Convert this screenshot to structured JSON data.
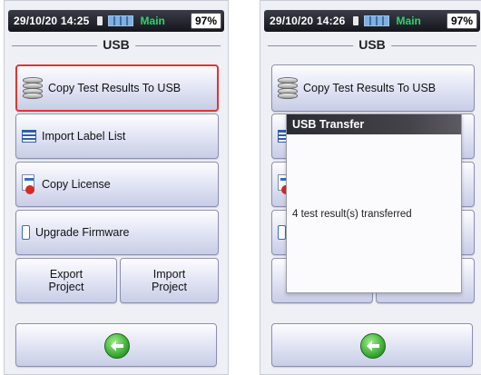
{
  "left": {
    "statusbar": {
      "time": "29/10/20 14:25",
      "mode": "Main",
      "battery": "97%"
    },
    "title": "USB",
    "buttons": {
      "copy_results": "Copy Test Results To USB",
      "import_label": "Import Label List",
      "copy_license": "Copy License",
      "upgrade_firmware": "Upgrade Firmware",
      "export_project": "Export\nProject",
      "import_project": "Import\nProject"
    },
    "selected_button": "copy_results",
    "icons": {
      "back": "back-arrow-icon",
      "db": "database-icon",
      "list": "list-icon",
      "license": "license-icon",
      "battery": "battery-icon"
    }
  },
  "right": {
    "statusbar": {
      "time": "29/10/20 14:26",
      "mode": "Main",
      "battery": "97%"
    },
    "title": "USB",
    "buttons": {
      "copy_results": "Copy Test Results To USB"
    },
    "dialog": {
      "title": "USB Transfer",
      "message": "4 test result(s) transferred"
    }
  },
  "colors": {
    "selected_border": "#e2352e",
    "mode_text": "#2bd46b",
    "back_button": "#2f9f2a"
  }
}
